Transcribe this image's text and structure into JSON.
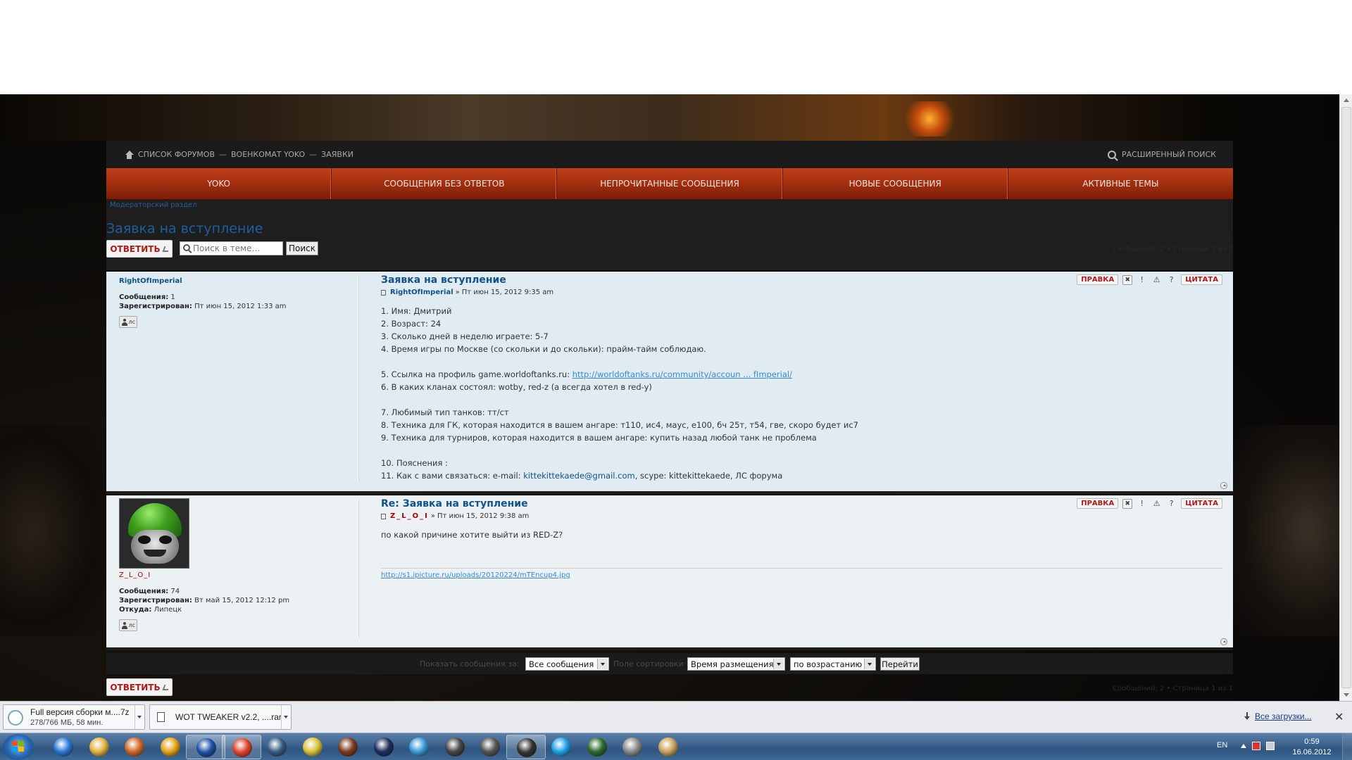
{
  "breadcrumb": {
    "items": [
      "СПИСОК ФОРУМОВ",
      "ВОЕНКОМАТ YOKO",
      "ЗАЯВКИ"
    ],
    "separator": "—"
  },
  "header_search": {
    "label": "РАСШИРЕННЫЙ ПОИСК"
  },
  "nav": {
    "items": [
      "YOKO",
      "СООБЩЕНИЯ БЕЗ ОТВЕТОВ",
      "НЕПРОЧИТАННЫЕ СООБЩЕНИЯ",
      "НОВЫЕ СООБЩЕНИЯ",
      "АКТИВНЫЕ ТЕМЫ"
    ]
  },
  "topic": {
    "mod_link": "Модераторский раздел",
    "title": "Заявка на вступление",
    "reply_label": "ОТВЕТИТЬ",
    "search_placeholder": "Поиск в теме…",
    "search_button": "Поиск",
    "page_info": "Сообщений: 2 • Страница 1 из 1"
  },
  "post_buttons": {
    "edit": "ПРАВКА",
    "quote": "ЦИТАТА",
    "delete": "✖",
    "warn": "!",
    "report": "⚠",
    "info": "?"
  },
  "posts": [
    {
      "title": "Заявка на вступление",
      "author": "RightOfImperial",
      "date": "Пт июн 15, 2012 9:35 am",
      "profile": {
        "username": "RightOfImperial",
        "posts_label": "Сообщения:",
        "posts": "1",
        "joined_label": "Зарегистрирован:",
        "joined": "Пт июн 15, 2012 1:33 am",
        "pm": "лс"
      },
      "lines": [
        "1. Имя: Дмитрий",
        "2. Возраст: 24",
        "3. Сколько дней в неделю играете: 5-7",
        "4. Время игры по Москве (со скольки и до скольки): прайм-тайм соблюдаю.",
        "",
        "5. Ссылка на профиль game.worldoftanks.ru: ",
        "6. В каких кланах состоял: wotby, red-z (а всегда хотел в red-y)",
        "",
        "7. Любимый тип танков: тт/ст",
        "8. Техника для ГК, которая находится в вашем ангаре: т110, ис4, маус, е100, бч 25т, т54, гве, скоро будет ис7",
        "9. Техника для турниров, которая находится в вашем ангаре: купить назад любой танк не проблема",
        "",
        "10. Пояснения :",
        "11. Как с вами связаться: e-mail: "
      ],
      "profile_link": "http://worldoftanks.ru/community/accoun ... fImperial/",
      "email": "kittekittekaede@gmail.com",
      "contact_tail": ", scype: kittekittekaede, ЛС форума"
    },
    {
      "title": "Re: Заявка на вступление",
      "author": "Z_L_O_I",
      "date": "Пт июн 15, 2012 9:38 am",
      "profile": {
        "username": "Z_L_O_I",
        "posts_label": "Сообщения:",
        "posts": "74",
        "joined_label": "Зарегистрирован:",
        "joined": "Вт май 15, 2012 12:12 pm",
        "from_label": "Откуда:",
        "from": "Липецк",
        "pm": "лс"
      },
      "text": "по какой причине хотите выйти из RED-Z?",
      "signature_link": "http://s1.ipicture.ru/uploads/20120224/mTEncup4.jpg"
    }
  ],
  "sort_bar": {
    "show_label": "Показать сообщения за:",
    "show_value": "Все сообщения",
    "sort_label": "Поле сортировки",
    "sort_value": "Время размещения",
    "order_value": "по возрастанию",
    "go": "Перейти"
  },
  "downloads": {
    "items": [
      {
        "name": "Full версия сборки м....7z",
        "status": "278/766 МБ, 58 мин."
      },
      {
        "name": "WOT TWEAKER v2.2, ....rar"
      }
    ],
    "all_label": "Все загрузки...",
    "close": "✕"
  },
  "taskbar": {
    "lang": "EN",
    "time": "0:59",
    "date": "16.06.2012",
    "apps": [
      "ie-icon",
      "explorer-icon",
      "media-player-icon",
      "chat-icon",
      "save-icon",
      "chrome-icon",
      "steam-icon",
      "v-icon",
      "diablo-icon",
      "league-icon",
      "hummingbird-icon",
      "wot-icon",
      "wot-assistant-icon",
      "wot-launcher-icon",
      "skype-icon",
      "monitor-icon",
      "disc-icon",
      "paint-icon"
    ]
  },
  "colors": {
    "nav_accent": "#a22e0f",
    "link": "#105289",
    "reply_red": "#b11818"
  }
}
